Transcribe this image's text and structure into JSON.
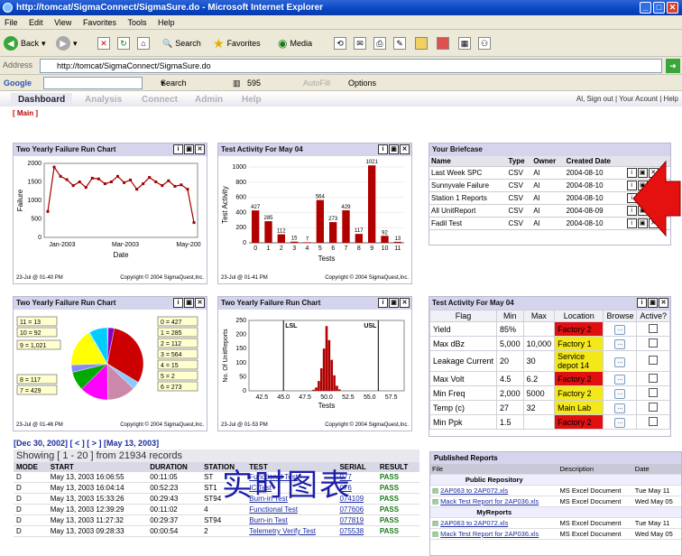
{
  "window": {
    "title": "http://tomcat/SigmaConnect/SigmaSure.do - Microsoft Internet Explorer"
  },
  "menu": [
    "File",
    "Edit",
    "View",
    "Favorites",
    "Tools",
    "Help"
  ],
  "toolbar": {
    "back": "Back",
    "search": "Search",
    "favorites": "Favorites",
    "media": "Media"
  },
  "address": {
    "label": "Address",
    "url": "http://tomcat/SigmaConnect/SigmaSure.do"
  },
  "googlebar": {
    "brand": "Google",
    "search_web": "Search Web",
    "blocked": "595 blocked",
    "autofill": "AutoFill",
    "options": "Options"
  },
  "nav": {
    "tabs": [
      "Dashboard",
      "Analysis",
      "Connect",
      "Admin",
      "Help"
    ],
    "user_links": "Al, Sign out | Your Acount | Help",
    "subnav": "[ Main ]"
  },
  "panels": {
    "p1": {
      "title": "Two Yearly Failure Run Chart",
      "stamp": "23-Jul @ 01-40 PM",
      "copyright": "Copyright © 2004 SigmaQuest,Inc."
    },
    "p2": {
      "title": "Test Activity For May 04",
      "stamp": "23-Jul @ 01-41 PM",
      "copyright": "Copyright © 2004 SigmaQuest,Inc."
    },
    "p3": {
      "title": "Two Yearly Failure Run Chart",
      "stamp": "23-Jul @ 01-46 PM",
      "copyright": "Copyright © 2004 SigmaQuest,Inc."
    },
    "p4": {
      "title": "Two Yearly Failure Run Chart",
      "stamp": "23-Jul @ 01-53 PM",
      "copyright": "Copyright © 2004 SigmaQuest,Inc."
    }
  },
  "chart_data": [
    {
      "type": "line",
      "title": "",
      "xlabel": "Date",
      "ylabel": "Failure",
      "ylim": [
        0,
        2000
      ],
      "x_ticks": [
        "Jan-2003",
        "Mar-2003",
        "May-200"
      ],
      "y_ticks": [
        "0",
        "500",
        "1000",
        "1500",
        "2000"
      ],
      "values": [
        700,
        1900,
        1650,
        1560,
        1400,
        1500,
        1350,
        1600,
        1580,
        1450,
        1500,
        1650,
        1480,
        1550,
        1300,
        1450,
        1620,
        1500,
        1400,
        1530,
        1380,
        1420,
        1300,
        400
      ]
    },
    {
      "type": "bar",
      "title": "",
      "xlabel": "Tests",
      "ylabel": "Test Activity",
      "ylim": [
        0,
        1000
      ],
      "categories": [
        "0",
        "1",
        "2",
        "3",
        "4",
        "5",
        "6",
        "7",
        "8",
        "9",
        "10",
        "11"
      ],
      "values": [
        427,
        285,
        112,
        15,
        7,
        564,
        273,
        429,
        117,
        1021,
        92,
        13
      ],
      "y_ticks": [
        "0",
        "200",
        "400",
        "600",
        "800",
        "1000"
      ]
    },
    {
      "type": "pie",
      "labels": [
        "11 = 13",
        "10 = 92",
        "9 = 1,021",
        "8 = 117",
        "7 = 429",
        "0 = 427",
        "1 = 285",
        "2 = 112",
        "3 = 564",
        "4 = 15",
        "5 = 2",
        "6 = 273"
      ],
      "values": [
        13,
        92,
        1021,
        117,
        429,
        427,
        285,
        112,
        564,
        15,
        2,
        273
      ],
      "colors": [
        "#ff8800",
        "#8800cc",
        "#cc0000",
        "#88ccff",
        "#cc88aa",
        "#ff00ff",
        "#00aa00",
        "#8888ff",
        "#ffff00",
        "#00ffff",
        "#333333",
        "#00ccff"
      ]
    },
    {
      "type": "histogram",
      "xlabel": "Tests",
      "ylabel": "No. Of UnitReports",
      "ylim": [
        0,
        250
      ],
      "x_ticks": [
        "42.5",
        "45.0",
        "47.5",
        "50.0",
        "52.5",
        "55.0",
        "57.5"
      ],
      "y_ticks": [
        "0",
        "50",
        "100",
        "150",
        "200",
        "250"
      ],
      "lsl_label": "LSL",
      "usl_label": "USL",
      "lsl": 45.0,
      "usl": 56.0,
      "bins_center": [
        48.5,
        48.8,
        49.1,
        49.4,
        49.7,
        50.0,
        50.3,
        50.6,
        50.9,
        51.2,
        51.5
      ],
      "values": [
        4,
        12,
        35,
        80,
        150,
        230,
        180,
        110,
        55,
        18,
        5
      ]
    }
  ],
  "briefcase": {
    "title": "Your Briefcase",
    "headers": [
      "Name",
      "Type",
      "Owner",
      "Created Date"
    ],
    "rows": [
      [
        "Last Week SPC",
        "CSV",
        "Al",
        "2004-08-10"
      ],
      [
        "Sunnyvale Failure",
        "CSV",
        "Al",
        "2004-08-10"
      ],
      [
        "Station 1 Reports",
        "CSV",
        "Al",
        "2004-08-10"
      ],
      [
        "All UnitReport",
        "CSV",
        "Al",
        "2004-08-09"
      ],
      [
        "Fadil Test",
        "CSV",
        "Al",
        "2004-08-10"
      ]
    ]
  },
  "activity": {
    "title": "Test Activity For May 04",
    "headers": [
      "Flag",
      "Min",
      "Max",
      "Location",
      "Browse",
      "Active?"
    ],
    "rows": [
      {
        "flag": "Yield",
        "min": "85%",
        "max": "",
        "loc": "Factory 2",
        "color": "#e01010"
      },
      {
        "flag": "Max dBz",
        "min": "5,000",
        "max": "10,000",
        "loc": "Factory 1",
        "color": "#f3e81a"
      },
      {
        "flag": "Leakage Current",
        "min": "20",
        "max": "30",
        "loc": "Service depot 14",
        "color": "#f3e81a"
      },
      {
        "flag": "Max Volt",
        "min": "4.5",
        "max": "6.2",
        "loc": "Factory 2",
        "color": "#e01010"
      },
      {
        "flag": "Min Freq",
        "min": "2,000",
        "max": "5000",
        "loc": "Factory 2",
        "color": "#f3e81a"
      },
      {
        "flag": "Temp (c)",
        "min": "27",
        "max": "32",
        "loc": "Main Lab",
        "color": "#f3e81a"
      },
      {
        "flag": "Min Ppk",
        "min": "1.5",
        "max": "",
        "loc": "Factory 2",
        "color": "#e01010"
      }
    ]
  },
  "records": {
    "nav": "[Dec 30, 2002] [ < ] [ > ] [May 13, 2003]",
    "showing": "Showing [ 1 - 20 ] from 21934 records",
    "headers": [
      "MODE",
      "START",
      "DURATION",
      "STATION",
      "TEST",
      "SERIAL",
      "RESULT"
    ],
    "rows": [
      [
        "D",
        "May 13, 2003 16:06:55",
        "00:11:05",
        "ST",
        "Functional Test",
        "077",
        "PASS"
      ],
      [
        "D",
        "May 13, 2003 16:04:14",
        "00:52:23",
        "ST1",
        "IC Test",
        "076",
        "PASS"
      ],
      [
        "D",
        "May 13, 2003 15:33:26",
        "00:29:43",
        "ST94",
        "Burn-in Test",
        "074109",
        "PASS"
      ],
      [
        "D",
        "May 13, 2003 12:39:29",
        "00:11:02",
        "4",
        "Functional Test",
        "077606",
        "PASS"
      ],
      [
        "D",
        "May 13, 2003 11:27:32",
        "00:29:37",
        "ST94",
        "Burn-in Test",
        "077819",
        "PASS"
      ],
      [
        "D",
        "May 13, 2003 09:28:33",
        "00:00:54",
        "2",
        "Telemetry Verify Test",
        "075538",
        "PASS"
      ]
    ]
  },
  "overlay": "实时图表",
  "published": {
    "title": "Published Reports",
    "headers": [
      "File",
      "Description",
      "Date"
    ],
    "sections": [
      {
        "name": "Public Repository",
        "rows": [
          [
            "2AP063 to 2AP072.xls",
            "MS Excel Document",
            "Tue May 11"
          ],
          [
            "Mack Test Report for 2AP036.xls",
            "MS Excel Document",
            "Wed May 05"
          ]
        ]
      },
      {
        "name": "MyReports",
        "rows": [
          [
            "2AP063 to 2AP072.xls",
            "MS Excel Document",
            "Tue May 11"
          ],
          [
            "Mack Test Report for 2AP036.xls",
            "MS Excel Document",
            "Wed May 05"
          ]
        ]
      }
    ]
  }
}
